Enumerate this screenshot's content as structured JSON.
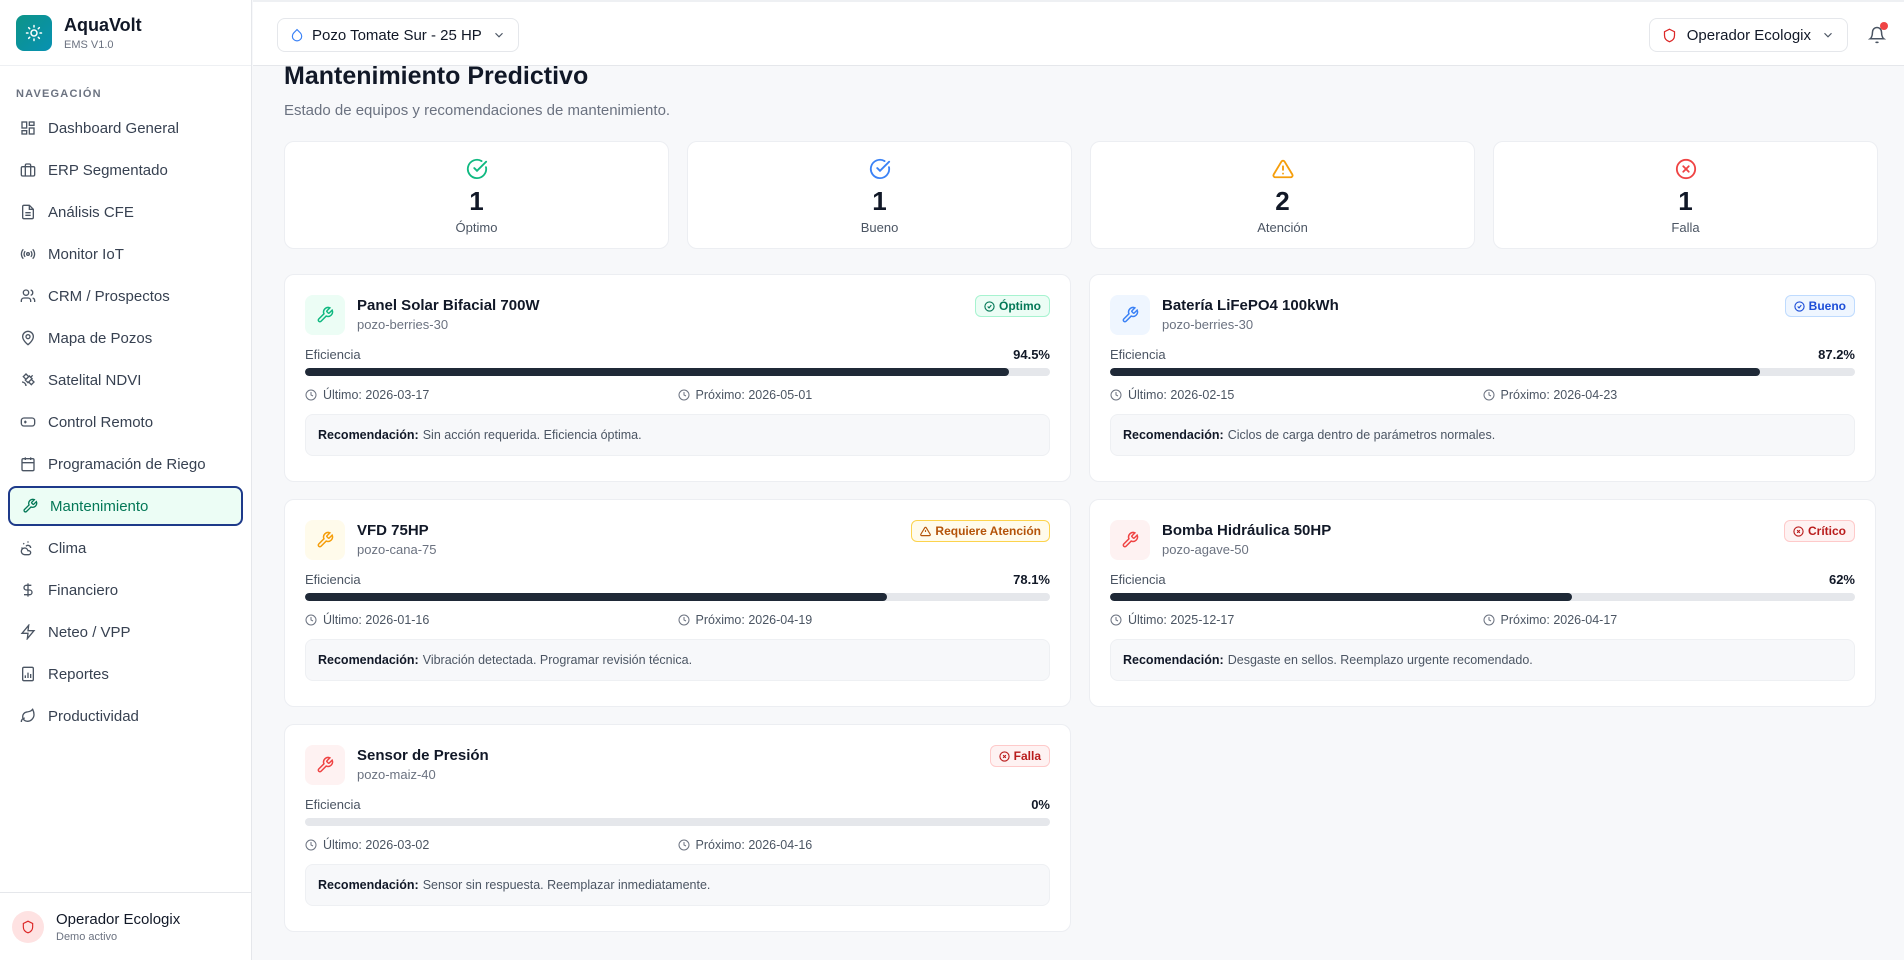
{
  "app": {
    "name": "AquaVolt",
    "version": "EMS V1.0"
  },
  "sidebar": {
    "section_title": "NAVEGACIÓN",
    "items": [
      {
        "label": "Dashboard General",
        "icon": "layout-dashboard-icon"
      },
      {
        "label": "ERP Segmentado",
        "icon": "briefcase-icon"
      },
      {
        "label": "Análisis CFE",
        "icon": "file-text-icon"
      },
      {
        "label": "Monitor IoT",
        "icon": "radio-icon"
      },
      {
        "label": "CRM / Prospectos",
        "icon": "users-icon"
      },
      {
        "label": "Mapa de Pozos",
        "icon": "map-pin-icon"
      },
      {
        "label": "Satelital NDVI",
        "icon": "satellite-icon"
      },
      {
        "label": "Control Remoto",
        "icon": "gamepad-icon"
      },
      {
        "label": "Programación de Riego",
        "icon": "calendar-icon"
      },
      {
        "label": "Mantenimiento",
        "icon": "wrench-icon",
        "active": true
      },
      {
        "label": "Clima",
        "icon": "cloud-sun-icon"
      },
      {
        "label": "Financiero",
        "icon": "dollar-icon"
      },
      {
        "label": "Neteo / VPP",
        "icon": "zap-icon"
      },
      {
        "label": "Reportes",
        "icon": "report-icon"
      },
      {
        "label": "Productividad",
        "icon": "leaf-icon"
      }
    ],
    "user": {
      "name": "Operador Ecologix",
      "status": "Demo activo"
    }
  },
  "topbar": {
    "well_selector": "Pozo Tomate Sur - 25 HP",
    "operator": "Operador Ecologix"
  },
  "page": {
    "title": "Mantenimiento Predictivo",
    "subtitle": "Estado de equipos y recomendaciones de mantenimiento."
  },
  "stats": [
    {
      "value": "1",
      "label": "Óptimo",
      "color": "#10b981"
    },
    {
      "value": "1",
      "label": "Bueno",
      "color": "#3b82f6"
    },
    {
      "value": "2",
      "label": "Atención",
      "color": "#f59e0b"
    },
    {
      "value": "1",
      "label": "Falla",
      "color": "#ef4444"
    }
  ],
  "equipment": [
    {
      "name": "Panel Solar Bifacial 700W",
      "well": "pozo-berries-30",
      "status": "Óptimo",
      "status_type": "optimo",
      "efficiency_label": "Eficiencia",
      "efficiency": "94.5%",
      "efficiency_value": 94.5,
      "last_label": "Último:",
      "last": "2026-03-17",
      "next_label": "Próximo:",
      "next": "2026-05-01",
      "rec_label": "Recomendación:",
      "recommendation": "Sin acción requerida. Eficiencia óptima."
    },
    {
      "name": "Batería LiFePO4 100kWh",
      "well": "pozo-berries-30",
      "status": "Bueno",
      "status_type": "bueno",
      "efficiency_label": "Eficiencia",
      "efficiency": "87.2%",
      "efficiency_value": 87.2,
      "last_label": "Último:",
      "last": "2026-02-15",
      "next_label": "Próximo:",
      "next": "2026-04-23",
      "rec_label": "Recomendación:",
      "recommendation": "Ciclos de carga dentro de parámetros normales."
    },
    {
      "name": "VFD 75HP",
      "well": "pozo-cana-75",
      "status": "Requiere Atención",
      "status_type": "atencion",
      "efficiency_label": "Eficiencia",
      "efficiency": "78.1%",
      "efficiency_value": 78.1,
      "last_label": "Último:",
      "last": "2026-01-16",
      "next_label": "Próximo:",
      "next": "2026-04-19",
      "rec_label": "Recomendación:",
      "recommendation": "Vibración detectada. Programar revisión técnica."
    },
    {
      "name": "Bomba Hidráulica 50HP",
      "well": "pozo-agave-50",
      "status": "Crítico",
      "status_type": "critico",
      "efficiency_label": "Eficiencia",
      "efficiency": "62%",
      "efficiency_value": 62,
      "last_label": "Último:",
      "last": "2025-12-17",
      "next_label": "Próximo:",
      "next": "2026-04-17",
      "rec_label": "Recomendación:",
      "recommendation": "Desgaste en sellos. Reemplazo urgente recomendado."
    },
    {
      "name": "Sensor de Presión",
      "well": "pozo-maiz-40",
      "status": "Falla",
      "status_type": "falla",
      "efficiency_label": "Eficiencia",
      "efficiency": "0%",
      "efficiency_value": 0,
      "last_label": "Último:",
      "last": "2026-03-02",
      "next_label": "Próximo:",
      "next": "2026-04-16",
      "rec_label": "Recomendación:",
      "recommendation": "Sensor sin respuesta. Reemplazar inmediatamente."
    }
  ]
}
